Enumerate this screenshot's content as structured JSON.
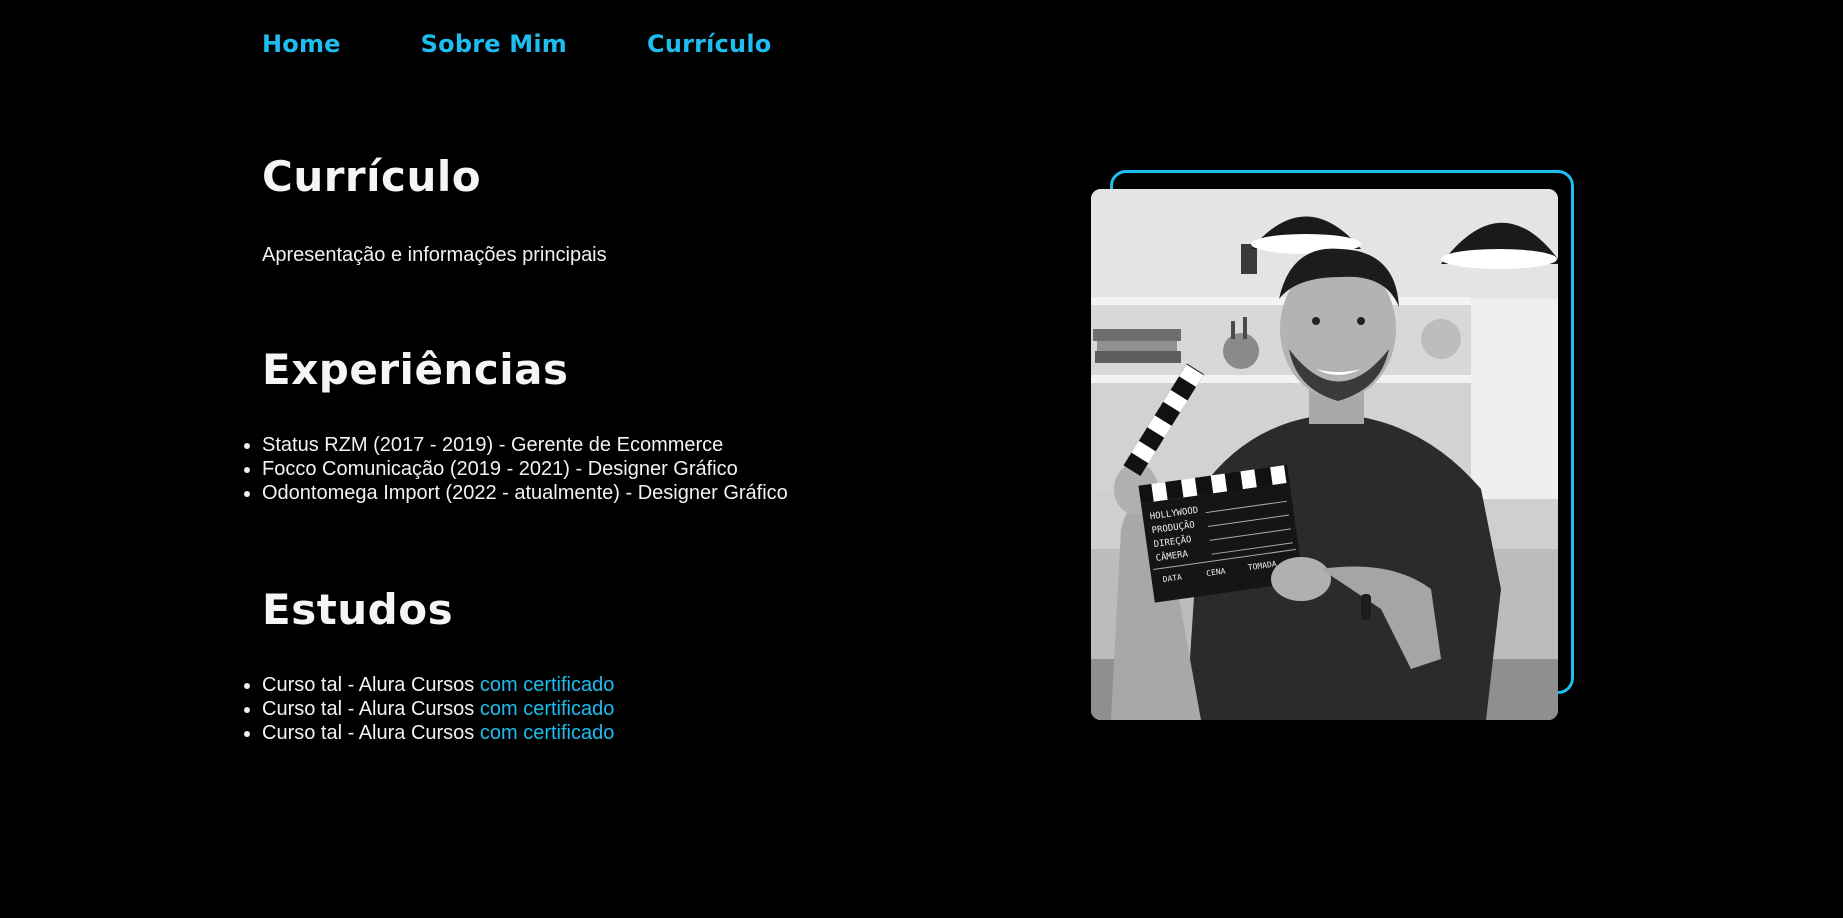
{
  "nav": {
    "items": [
      {
        "label": "Home"
      },
      {
        "label": "Sobre Mim"
      },
      {
        "label": "Currículo"
      }
    ]
  },
  "page": {
    "title": "Currículo",
    "intro": "Apresentação e informações principais"
  },
  "experience": {
    "heading": "Experiências",
    "items": [
      "Status RZM (2017 - 2019) - Gerente de Ecommerce",
      "Focco Comunicação (2019 - 2021) - Designer Gráfico",
      "Odontomega Import (2022 - atualmente) - Designer Gráfico"
    ]
  },
  "studies": {
    "heading": "Estudos",
    "items": [
      {
        "text": "Curso tal - Alura Cursos ",
        "link": "com certificado"
      },
      {
        "text": "Curso tal - Alura Cursos ",
        "link": "com certificado"
      },
      {
        "text": "Curso tal - Alura Cursos ",
        "link": "com certificado"
      }
    ]
  },
  "clapperboard": {
    "lines": [
      "HOLLYWOOD",
      "PRODUÇÃO",
      "DIREÇÃO",
      "CÂMERA"
    ],
    "bottom": [
      "DATA",
      "CENA",
      "TOMADA"
    ]
  },
  "colors": {
    "background": "#000000",
    "accent": "#1ebdf0",
    "text": "#f2f2f2"
  }
}
